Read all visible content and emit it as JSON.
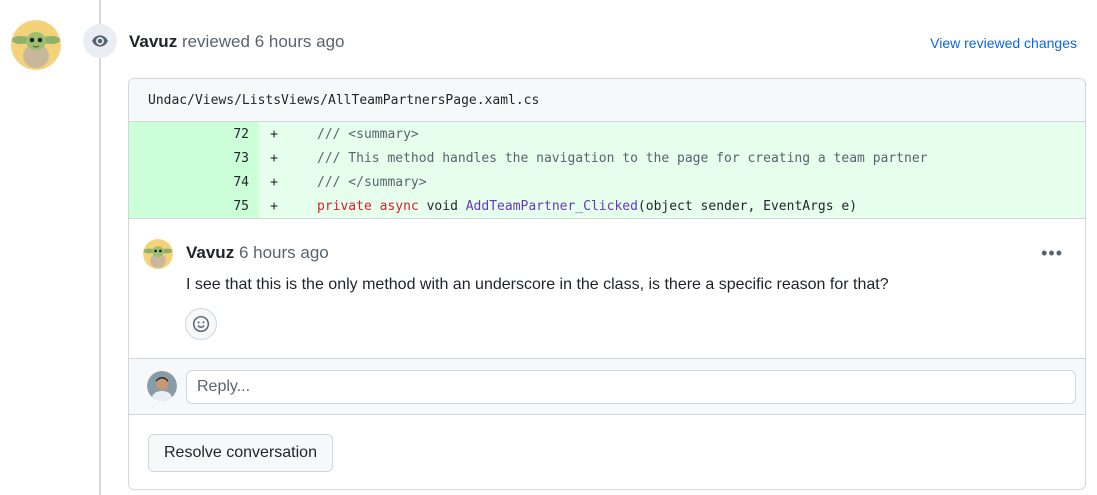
{
  "review": {
    "author": "Vavuz",
    "action": "reviewed",
    "time": "6 hours ago",
    "view_changes_label": "View reviewed changes"
  },
  "file": {
    "path": "Undac/Views/ListsViews/AllTeamPartnersPage.xaml.cs"
  },
  "diff": {
    "lines": [
      {
        "num": "72",
        "marker": "+"
      },
      {
        "num": "73",
        "marker": "+"
      },
      {
        "num": "74",
        "marker": "+"
      },
      {
        "num": "75",
        "marker": "+"
      }
    ],
    "line72": "/// <summary>",
    "line73": "/// This method handles the navigation to the page for creating a team partner",
    "line74": "/// </summary>",
    "line75": {
      "kw_private": "private",
      "kw_async": "async",
      "type_void": "void",
      "func_name": "AddTeamPartner_Clicked",
      "params": "(object sender, EventArgs e)"
    }
  },
  "comment": {
    "author": "Vavuz",
    "time": "6 hours ago",
    "body": "I see that this is the only method with an underscore in the class, is there a specific reason for that?",
    "menu_label": "•••"
  },
  "reply": {
    "placeholder": "Reply..."
  },
  "resolve": {
    "label": "Resolve conversation"
  },
  "colors": {
    "link": "#0969da",
    "addition_bg": "#e6ffec",
    "addition_num_bg": "#ccffd8",
    "keyword": "#cf222e",
    "function": "#6639ba"
  },
  "icons": {
    "review": "eye-icon",
    "reaction": "smiley-icon",
    "menu": "kebab-horizontal-icon"
  }
}
